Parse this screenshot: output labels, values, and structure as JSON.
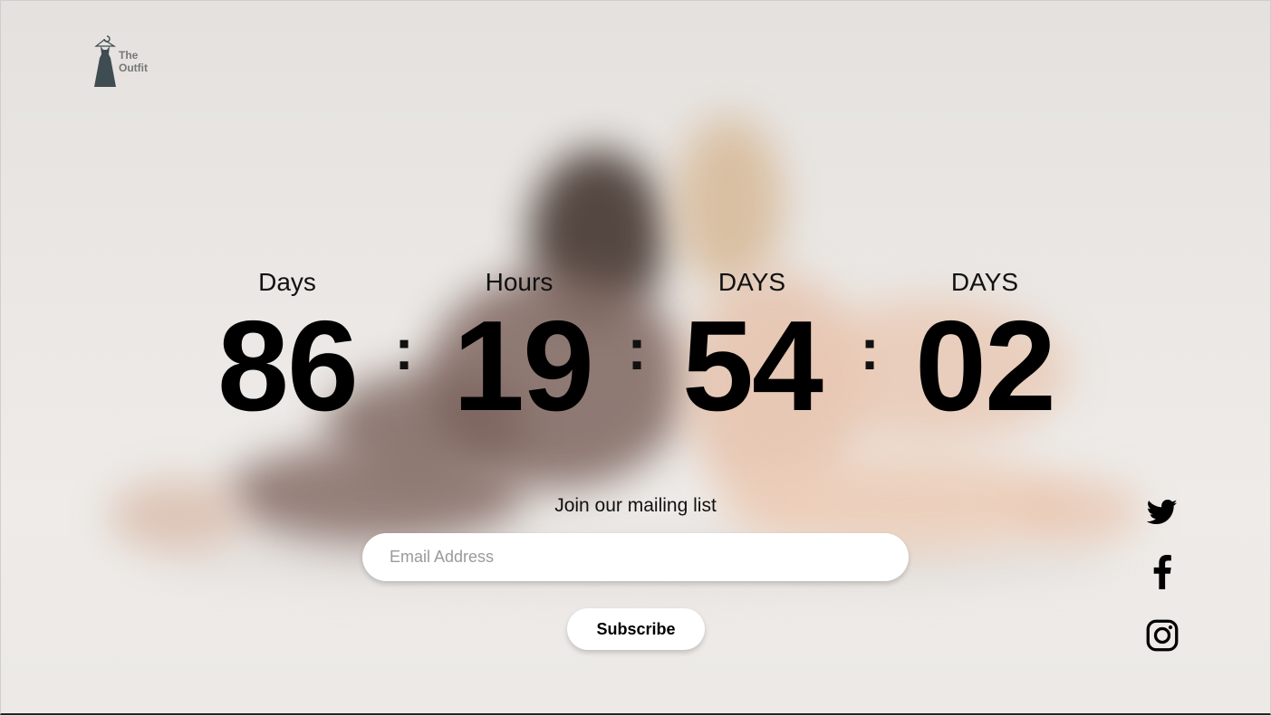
{
  "brand": {
    "line1": "The",
    "line2": "Outfit"
  },
  "countdown": [
    {
      "label": "Days",
      "value": "86"
    },
    {
      "label": "Hours",
      "value": "19"
    },
    {
      "label": "DAYS",
      "value": "54"
    },
    {
      "label": "DAYS",
      "value": "02"
    }
  ],
  "separator": ":",
  "mailing": {
    "title": "Join our mailing list",
    "email_placeholder": "Email Address",
    "email_value": "",
    "subscribe_label": "Subscribe"
  },
  "social": {
    "icons": [
      "twitter-icon",
      "facebook-icon",
      "instagram-icon"
    ]
  },
  "colors": {
    "text": "#000000",
    "logo_icon": "#3f4c52",
    "button_bg": "#ffffff"
  }
}
